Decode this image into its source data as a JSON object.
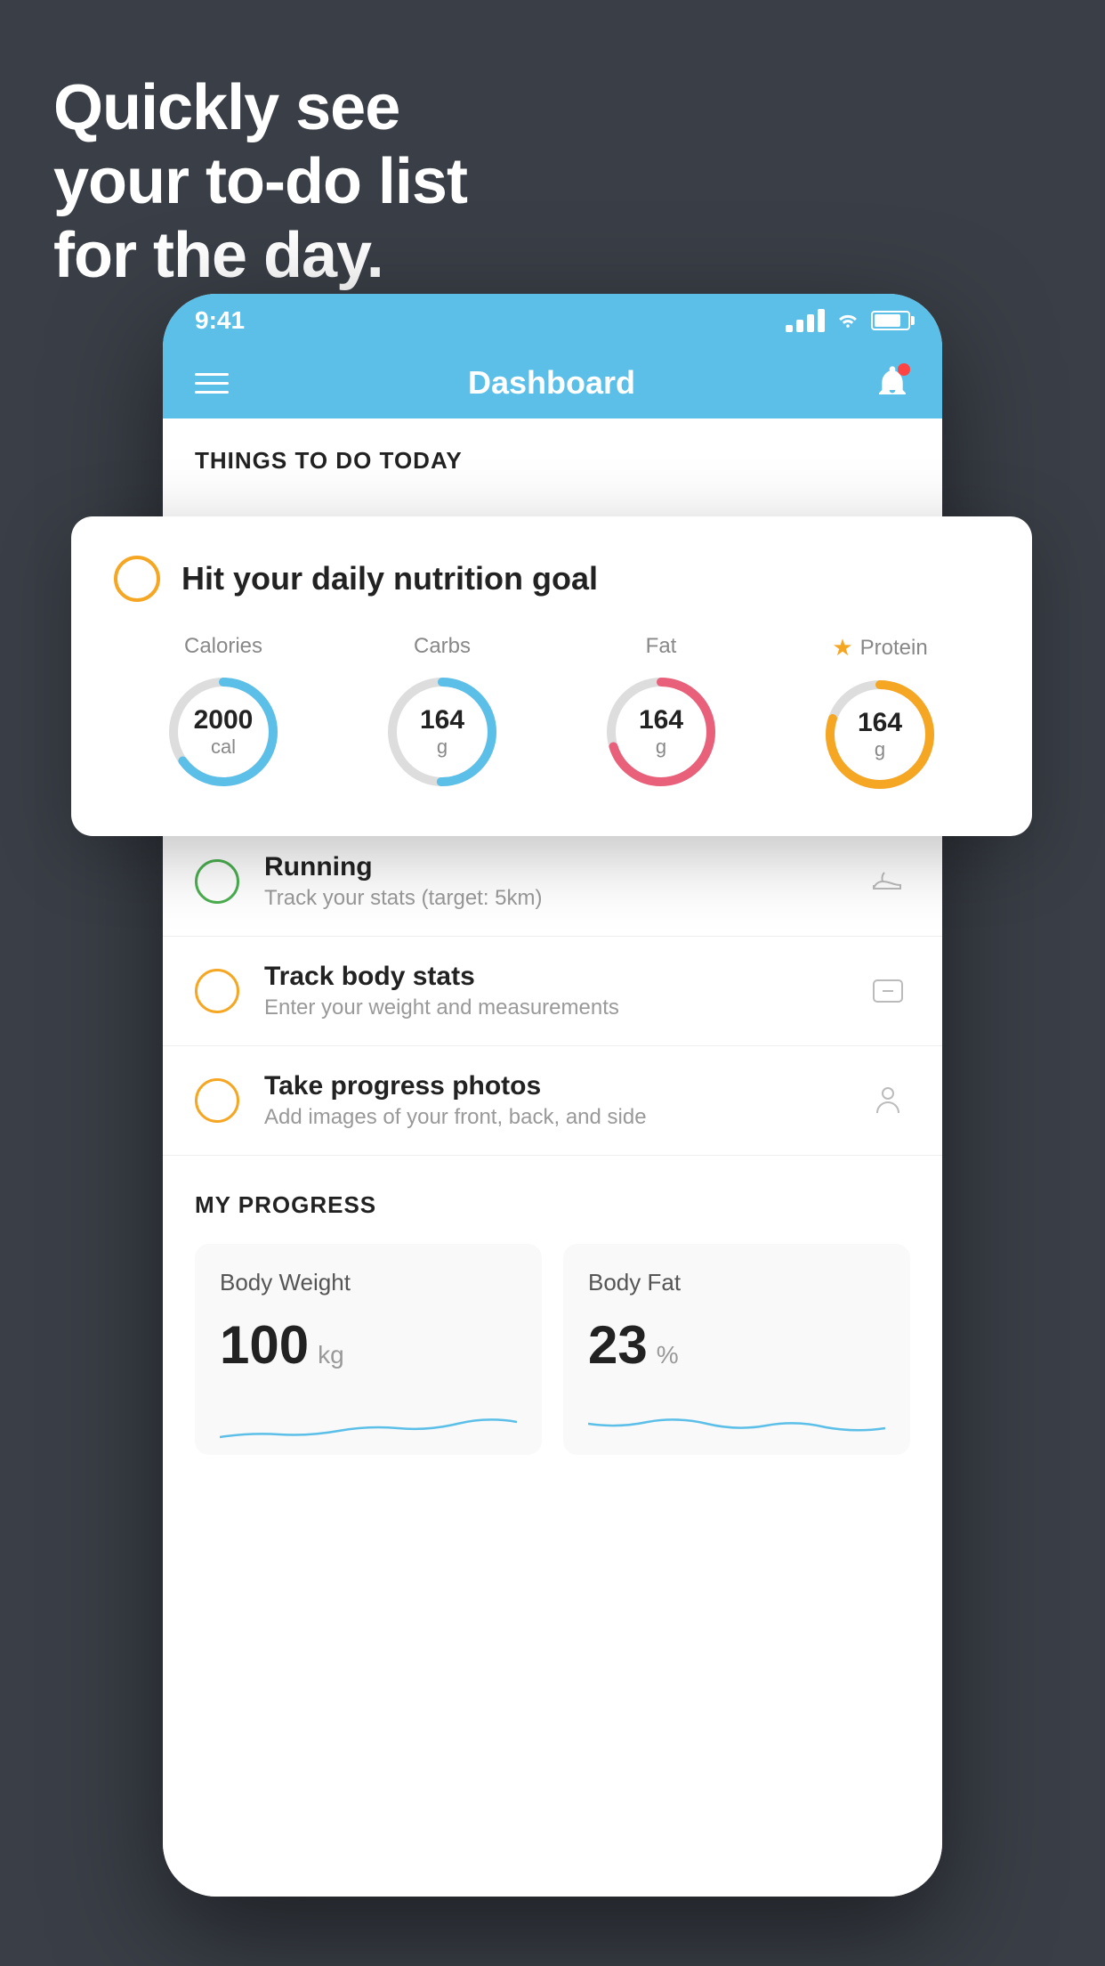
{
  "hero": {
    "title_line1": "Quickly see",
    "title_line2": "your to-do list",
    "title_line3": "for the day."
  },
  "status_bar": {
    "time": "9:41"
  },
  "nav": {
    "title": "Dashboard"
  },
  "things_section": {
    "header": "THINGS TO DO TODAY"
  },
  "floating_card": {
    "title": "Hit your daily nutrition goal",
    "items": [
      {
        "label": "Calories",
        "value": "2000",
        "unit": "cal",
        "color": "#5bbfe8",
        "track_color": "#ddd",
        "percent": 65
      },
      {
        "label": "Carbs",
        "value": "164",
        "unit": "g",
        "color": "#5bbfe8",
        "track_color": "#ddd",
        "percent": 50
      },
      {
        "label": "Fat",
        "value": "164",
        "unit": "g",
        "color": "#e8607a",
        "track_color": "#ddd",
        "percent": 70
      },
      {
        "label": "Protein",
        "value": "164",
        "unit": "g",
        "color": "#f5a623",
        "track_color": "#ddd",
        "percent": 80,
        "starred": true
      }
    ]
  },
  "todo_items": [
    {
      "title": "Running",
      "subtitle": "Track your stats (target: 5km)",
      "circle_color": "green",
      "icon": "shoe"
    },
    {
      "title": "Track body stats",
      "subtitle": "Enter your weight and measurements",
      "circle_color": "yellow",
      "icon": "scale"
    },
    {
      "title": "Take progress photos",
      "subtitle": "Add images of your front, back, and side",
      "circle_color": "yellow",
      "icon": "person"
    }
  ],
  "progress_section": {
    "header": "MY PROGRESS",
    "cards": [
      {
        "title": "Body Weight",
        "value": "100",
        "unit": "kg"
      },
      {
        "title": "Body Fat",
        "value": "23",
        "unit": "%"
      }
    ]
  },
  "colors": {
    "background": "#3a3f47",
    "blue": "#5bbfe8",
    "yellow": "#f5a623",
    "green": "#4caf50",
    "red": "#e8607a"
  }
}
